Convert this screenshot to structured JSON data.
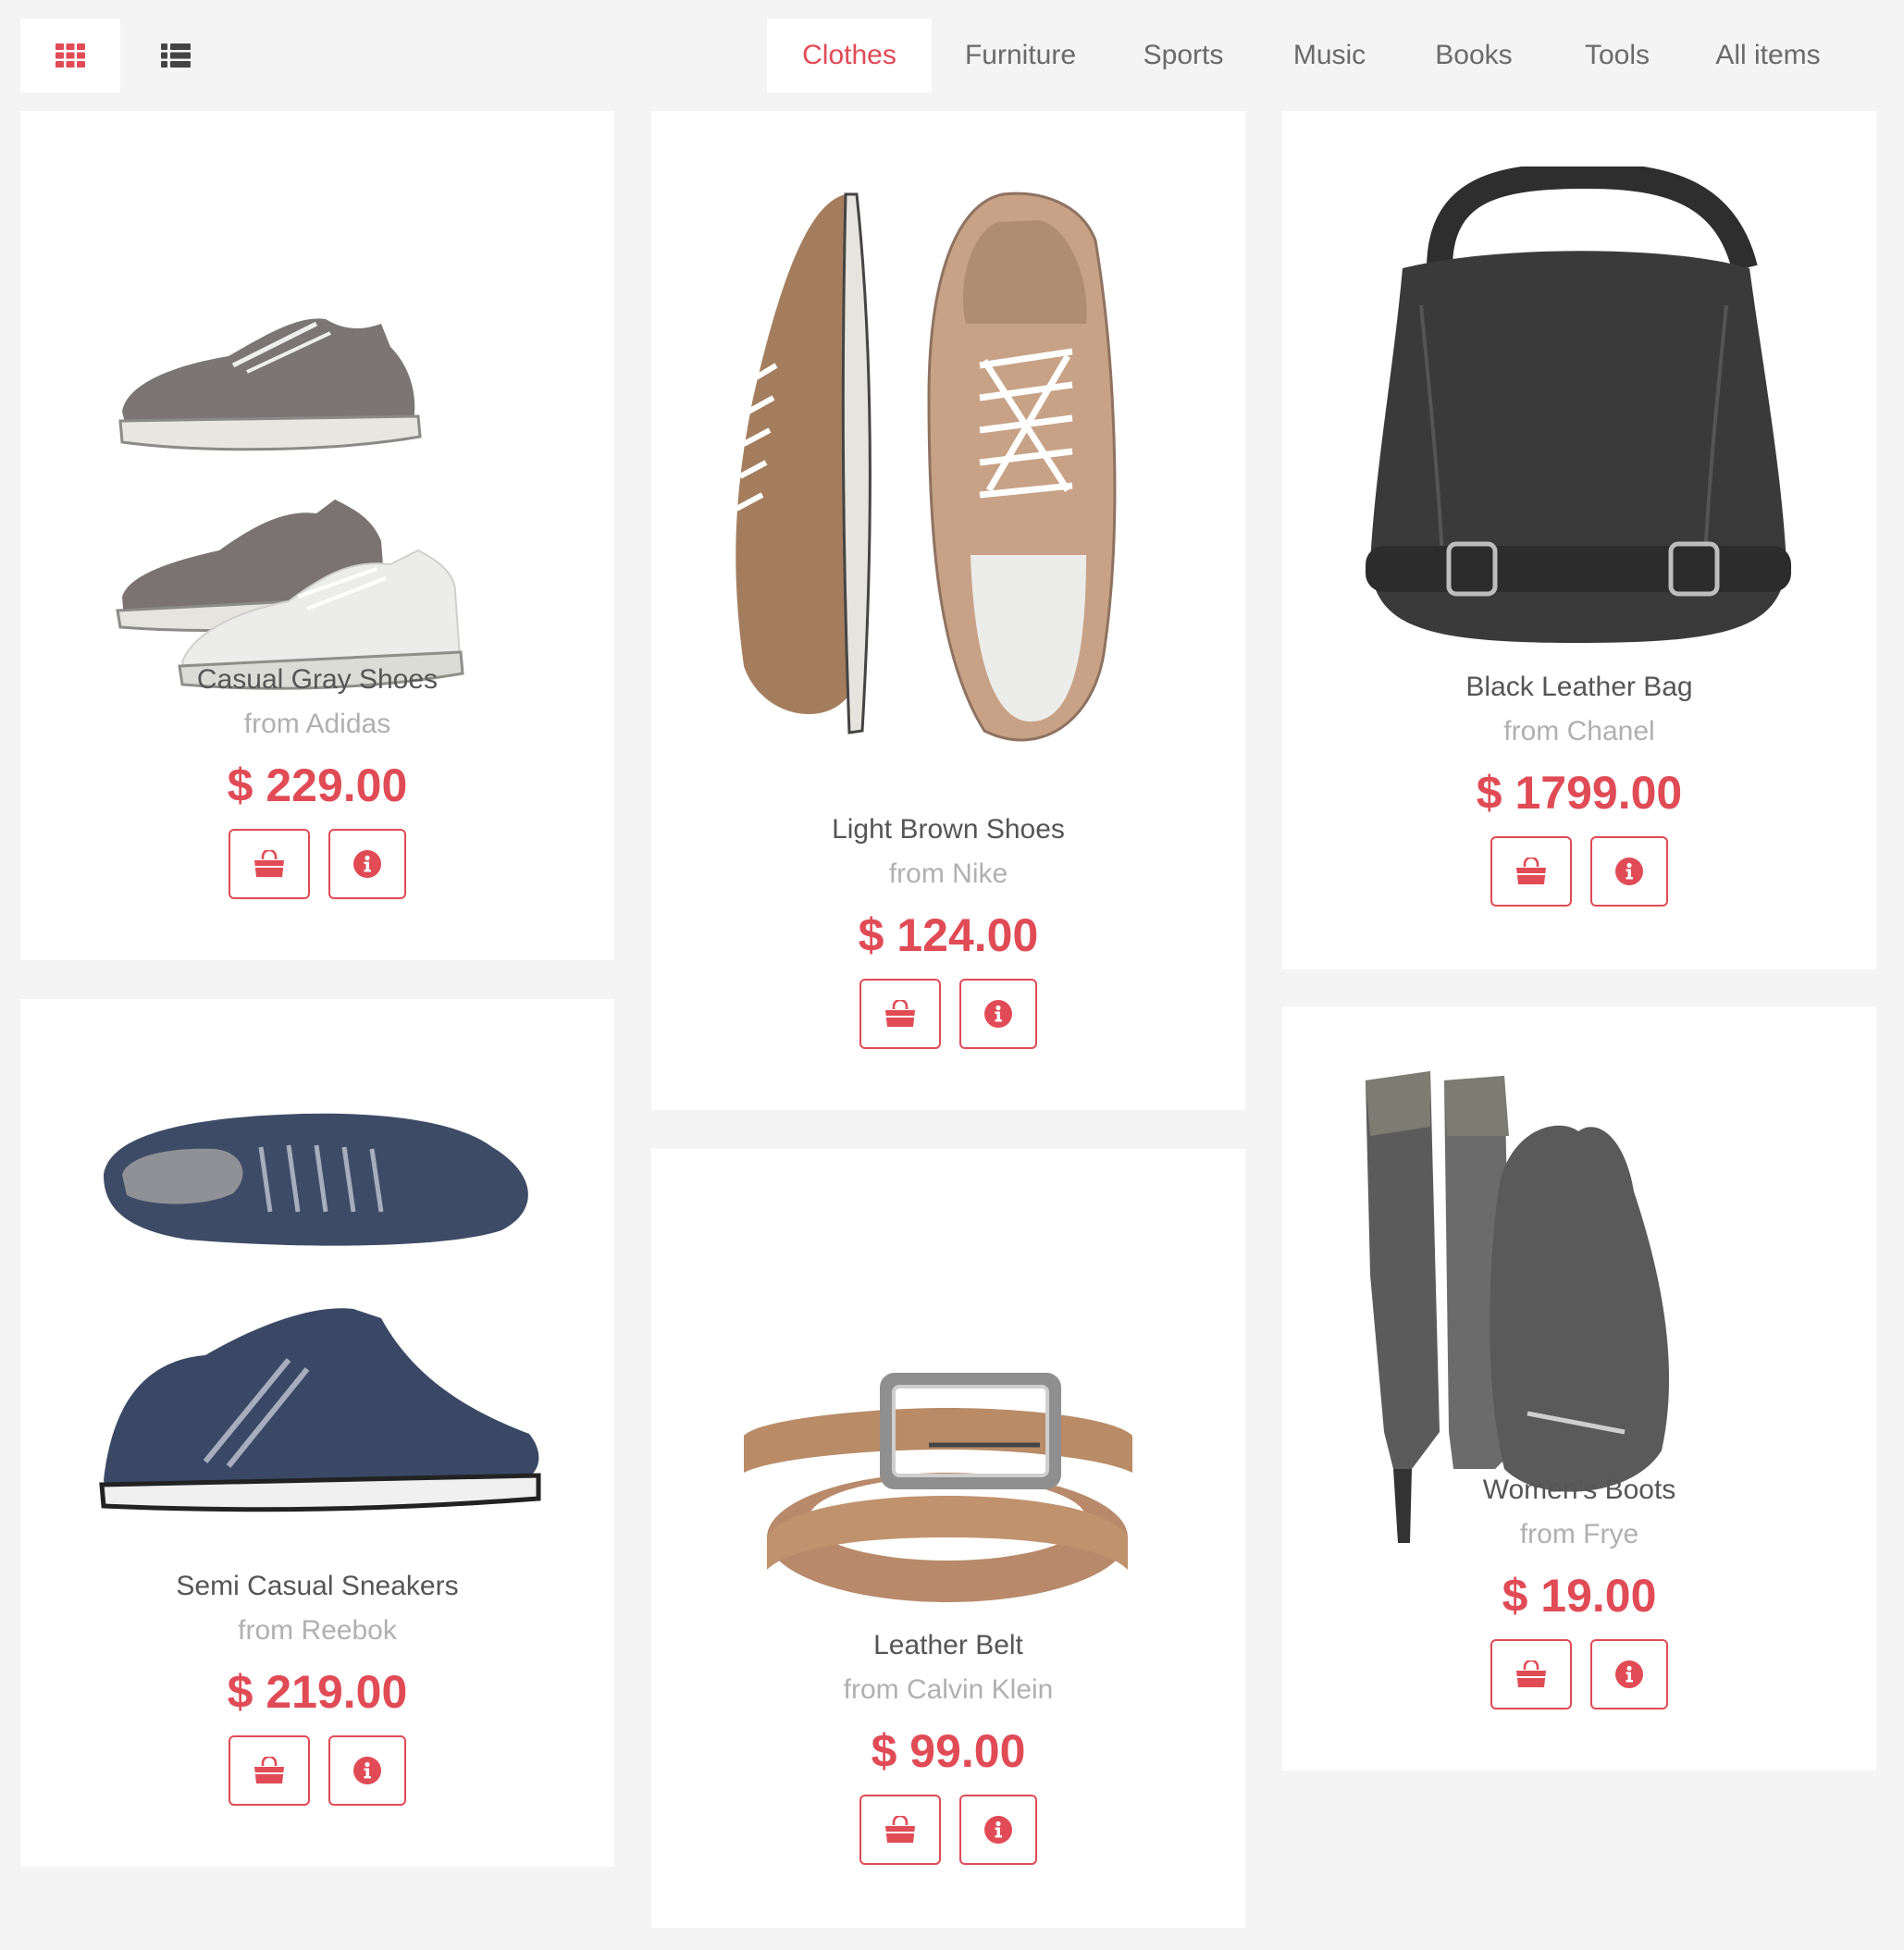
{
  "toolbar": {
    "grid_view": "grid-view-icon",
    "list_view": "list-view-icon"
  },
  "categories": [
    {
      "label": "Clothes",
      "active": true
    },
    {
      "label": "Furniture",
      "active": false
    },
    {
      "label": "Sports",
      "active": false
    },
    {
      "label": "Music",
      "active": false
    },
    {
      "label": "Books",
      "active": false
    },
    {
      "label": "Tools",
      "active": false
    },
    {
      "label": "All items",
      "active": false
    }
  ],
  "colors": {
    "accent": "#e04b55",
    "background": "#f4f4f4",
    "card": "#ffffff"
  },
  "products": [
    {
      "name": "Casual Gray Shoes",
      "brand": "from Adidas",
      "price": "$ 229.00",
      "image": "gray-sneakers-image"
    },
    {
      "name": "Light Brown Shoes",
      "brand": "from Nike",
      "price": "$ 124.00",
      "image": "brown-shoes-image"
    },
    {
      "name": "Black Leather Bag",
      "brand": "from Chanel",
      "price": "$ 1799.00",
      "image": "black-bag-image"
    },
    {
      "name": "Semi Casual Sneakers",
      "brand": "from Reebok",
      "price": "$ 219.00",
      "image": "navy-sneakers-image"
    },
    {
      "name": "Leather Belt",
      "brand": "from Calvin Klein",
      "price": "$ 99.00",
      "image": "leather-belt-image"
    },
    {
      "name": "Women's Boots",
      "brand": "from Frye",
      "price": "$ 19.00",
      "image": "boots-and-bag-image"
    }
  ],
  "buttons": {
    "cart": "shopping-bag-icon",
    "info": "info-icon"
  }
}
